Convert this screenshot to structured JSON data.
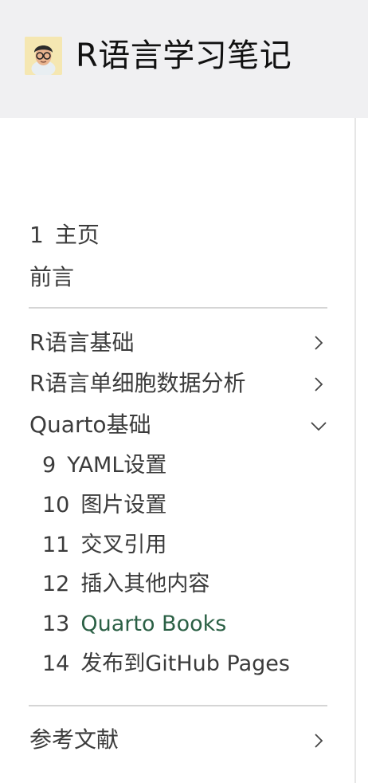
{
  "header": {
    "title": "R语言学习笔记",
    "logo": "avatar-memoji"
  },
  "sidebar": {
    "items": [
      {
        "number": "1",
        "label": "主页"
      },
      {
        "number": "",
        "label": "前言"
      }
    ],
    "sections": [
      {
        "label": "R语言基础",
        "expanded": false,
        "chevron": "chevron-right-icon"
      },
      {
        "label": "R语言单细胞数据分析",
        "expanded": false,
        "chevron": "chevron-right-icon"
      },
      {
        "label": "Quarto基础",
        "expanded": true,
        "chevron": "chevron-down-icon",
        "children": [
          {
            "number": "9",
            "label": "YAML设置"
          },
          {
            "number": "10",
            "label": "图片设置"
          },
          {
            "number": "11",
            "label": "交叉引用"
          },
          {
            "number": "12",
            "label": "插入其他内容"
          },
          {
            "number": "13",
            "label": "Quarto Books",
            "active": true
          },
          {
            "number": "14",
            "label": "发布到GitHub Pages"
          }
        ]
      }
    ],
    "footer_section": {
      "label": "参考文献",
      "expanded": false,
      "chevron": "chevron-right-icon"
    }
  },
  "colors": {
    "header_bg": "#f0f0f2",
    "text": "#3b3b3b",
    "active": "#2b6045",
    "divider": "#d5d5d5"
  }
}
